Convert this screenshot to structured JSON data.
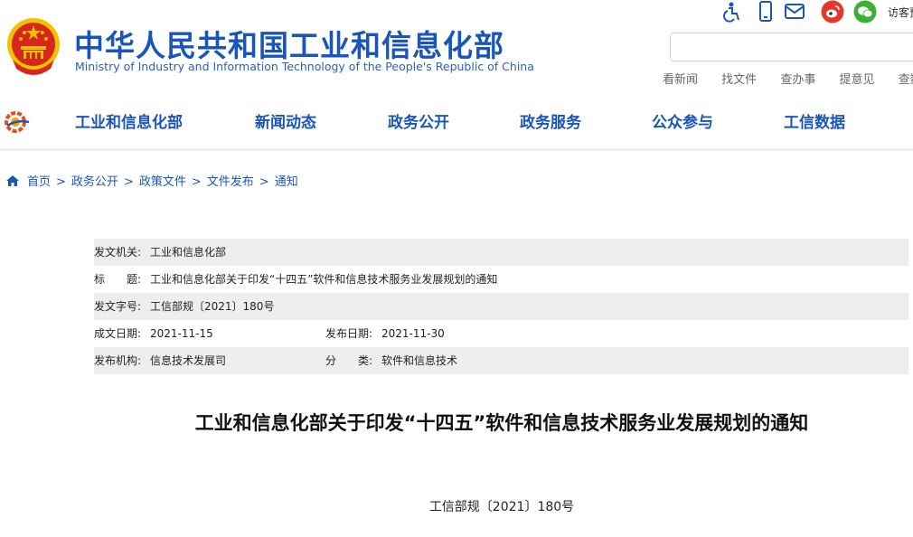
{
  "header": {
    "title": "中华人民共和国工业和信息化部",
    "subtitle": "Ministry of Industry and Information Technology of the People's Republic of China",
    "visitor_text": "访客预",
    "search_placeholder": "",
    "quick_links": [
      "看新闻",
      "找文件",
      "查办事",
      "提意见",
      "查数"
    ]
  },
  "top_icons": [
    "accessibility-icon",
    "mobile-icon",
    "mail-icon",
    "weibo-icon",
    "wechat-icon"
  ],
  "nav": {
    "items": [
      "工业和信息化部",
      "新闻动态",
      "政务公开",
      "政务服务",
      "公众参与",
      "工信数据"
    ]
  },
  "breadcrumb": {
    "items": [
      "首页",
      "政务公开",
      "政策文件",
      "文件发布",
      "通知"
    ],
    "separator": ">"
  },
  "info": {
    "issuer_label": "发文机关:",
    "issuer": "工业和信息化部",
    "title_label": "标　　题:",
    "title": "工业和信息化部关于印发“十四五”软件和信息技术服务业发展规划的通知",
    "docno_label": "发文字号:",
    "docno": "工信部规〔2021〕180号",
    "created_label": "成文日期:",
    "created": "2021-11-15",
    "published_label": "发布日期:",
    "published": "2021-11-30",
    "org_label": "发布机构:",
    "org": "信息技术发展司",
    "category_label": "分　　类:",
    "category": "软件和信息技术"
  },
  "document": {
    "heading": "工业和信息化部关于印发“十四五”软件和信息技术服务业发展规划的通知",
    "number": "工信部规〔2021〕180号"
  },
  "colors": {
    "brand_blue": "#1a56b8",
    "emblem_red": "#d7261e",
    "emblem_gold": "#f2c200",
    "weibo_red": "#e6372b",
    "wechat_green": "#3cb034"
  }
}
